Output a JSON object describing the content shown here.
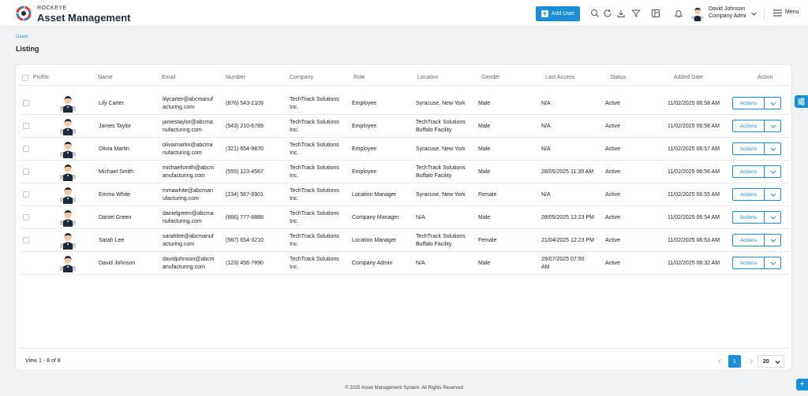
{
  "header": {
    "brand_small": "ROCKEYE",
    "brand_big": "Asset Management",
    "add_user_label": "Add User",
    "user_name": "David Johnson",
    "user_role": "Company Admi",
    "menu_label": "Menu"
  },
  "breadcrumb": "Users",
  "page_title": "Listing",
  "columns": [
    "Profile",
    "Name",
    "Email",
    "Number",
    "Company",
    "Role",
    "Location",
    "Gender",
    "Last Access",
    "Status",
    "Added Date",
    "Action"
  ],
  "rows": [
    {
      "name": "Lily Carter",
      "email": "lilycarter@abcmanuf\nacturing.com",
      "number": "(876) 543-2109",
      "company": "TechTrack Solutions\nInc.",
      "role": "Employee",
      "location": "Syracuse, New York",
      "gender": "Male",
      "last_access": "N/A",
      "status": "Active",
      "added": "11/02/2025 06:58 AM",
      "action": "Actions"
    },
    {
      "name": "James Taylor",
      "email": "jamestaylor@abcma\nnufacturing.com",
      "number": "(543) 210-6789",
      "company": "TechTrack Solutions\nInc.",
      "role": "Employee",
      "location": "TechTrack Solutions\nBuffalo Facility",
      "gender": "Male",
      "last_access": "N/A",
      "status": "Active",
      "added": "11/02/2025 06:58 AM",
      "action": "Actions"
    },
    {
      "name": "Olivia Martin",
      "email": "oliviamartin@abcma\nnufacturing.com",
      "number": "(321) 654-9870",
      "company": "TechTrack Solutions\nInc.",
      "role": "Employee",
      "location": "Syracuse, New York",
      "gender": "Male",
      "last_access": "N/A",
      "status": "Active",
      "added": "11/02/2025 06:57 AM",
      "action": "Actions"
    },
    {
      "name": "Michael Smith",
      "email": "michaelsmith@abcm\nanufacturing.com",
      "number": "(555) 123-4567",
      "company": "TechTrack Solutions\nInc.",
      "role": "Employee",
      "location": "TechTrack Solutions\nBuffalo Facility",
      "gender": "Male",
      "last_access": "28/05/2025 11:39 AM",
      "status": "Active",
      "added": "11/02/2025 06:56 AM",
      "action": "Actions"
    },
    {
      "name": "Emma White",
      "email": "mmawhite@abcman\nufacturing.com",
      "number": "(234) 567-8901",
      "company": "TechTrack Solutions\nInc.",
      "role": "Location Manager",
      "location": "Syracuse, New York",
      "gender": "Female",
      "last_access": "N/A",
      "status": "Active",
      "added": "11/02/2025 06:55 AM",
      "action": "Actions"
    },
    {
      "name": "Daniel Green",
      "email": "danielgreen@abcma\nnufacturing.com",
      "number": "(666) 777-8888",
      "company": "TechTrack Solutions\nInc.",
      "role": "Company Manager",
      "location": "N/A",
      "gender": "Male",
      "last_access": "28/05/2025 12:23 PM",
      "status": "Active",
      "added": "11/02/2025 06:54 AM",
      "action": "Actions"
    },
    {
      "name": "Sarah Lee",
      "email": "sarahlee@abcmanuf\nacturing.com",
      "number": "(987) 654-3210",
      "company": "TechTrack Solutions\nInc.",
      "role": "Location Manager",
      "location": "TechTrack Solutions\nBuffalo Facility",
      "gender": "Female",
      "last_access": "21/04/2025 12:23 PM",
      "status": "Active",
      "added": "11/02/2025 06:53 AM",
      "action": "Actions"
    },
    {
      "name": "David Johnson",
      "email": "davidjohnson@abcm\nanufacturing.com",
      "number": "(123) 456-7890",
      "company": "TechTrack Solutions\nInc.",
      "role": "Company Admin",
      "location": "N/A",
      "gender": "Male",
      "last_access": "29/07/2025 07:50\nAM",
      "status": "Active",
      "added": "11/02/2025 06:32 AM",
      "action": "Actions"
    }
  ],
  "pagination": {
    "view_count": "View 1 - 8 of 8",
    "current_page": "1",
    "per_page": "20"
  },
  "footer": "© 2025 Asset Management System. All Rights Reserved",
  "colors": {
    "primary": "#1a8fd8",
    "active": "#3aa537",
    "na": "#e03b3b"
  }
}
